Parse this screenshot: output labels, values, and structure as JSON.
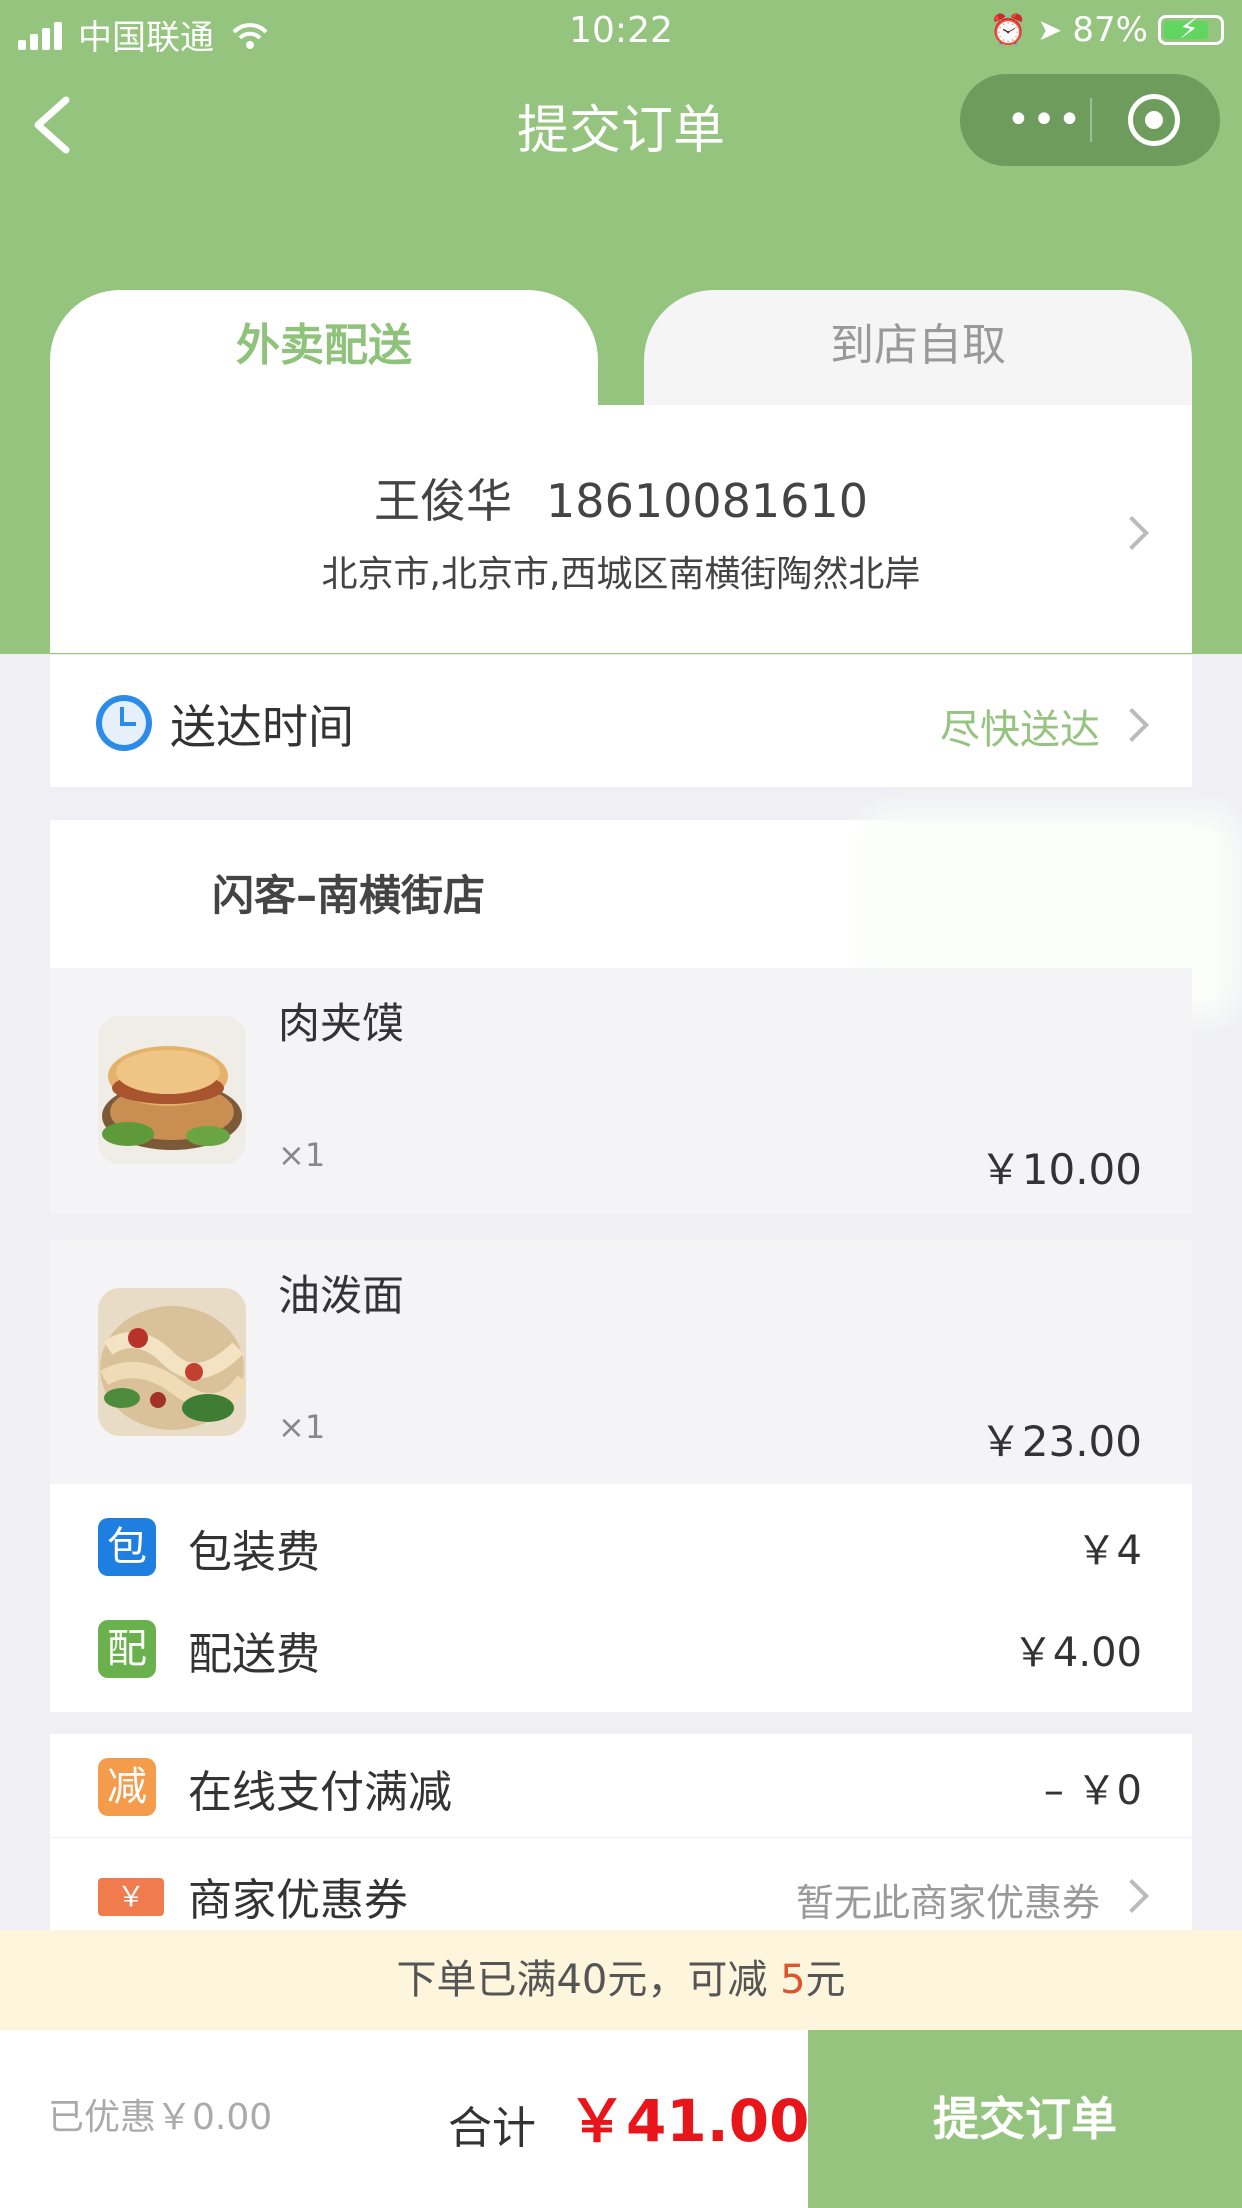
{
  "status_bar": {
    "carrier": "中国联通",
    "time": "10:22",
    "battery": "87%"
  },
  "nav": {
    "title": "提交订单",
    "more_icon": "more-dots-icon",
    "close_icon": "target-icon"
  },
  "tabs": [
    {
      "label": "外卖配送",
      "active": true
    },
    {
      "label": "到店自取",
      "active": false
    }
  ],
  "address": {
    "name": "王俊华",
    "phone": "18610081610",
    "line": "北京市,北京市,西城区南横街陶然北岸"
  },
  "delivery_time": {
    "label": "送达时间",
    "value": "尽快送达"
  },
  "shop": {
    "name": "闪客–南横街店"
  },
  "items": [
    {
      "name": "肉夹馍",
      "qty": "×1",
      "price": "￥10.00"
    },
    {
      "name": "油泼面",
      "qty": "×1",
      "price": "￥23.00"
    }
  ],
  "fees": [
    {
      "badge": "包",
      "label": "包装费",
      "value": "￥4",
      "color": "#1f7fe0"
    },
    {
      "badge": "配",
      "label": "配送费",
      "value": "￥4.00",
      "color": "#6ab04c"
    }
  ],
  "discounts": {
    "online": {
      "badge": "减",
      "label": "在线支付满减",
      "value": "– ￥0",
      "color": "#f59b4c"
    },
    "coupon": {
      "badge": "￥",
      "label": "商家优惠券",
      "value": "暂无此商家优惠券"
    }
  },
  "promo": {
    "text": "下单已满40元，可减 ",
    "amount": "5",
    "unit": "元"
  },
  "footer": {
    "saved": "已优惠￥0.00",
    "total_label": "合计",
    "total_value": "￥41.00",
    "submit_label": "提交订单"
  },
  "colors": {
    "brand_green": "#95c47f",
    "price_red": "#e8151b"
  }
}
